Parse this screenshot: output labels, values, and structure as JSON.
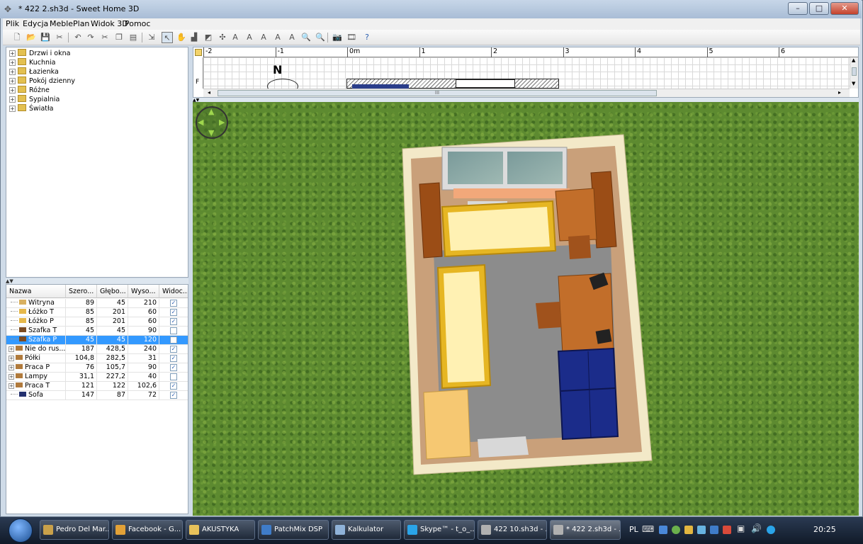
{
  "window": {
    "title": "* 422 2.sh3d - Sweet Home 3D",
    "minimize": "–",
    "maximize": "□",
    "close": "✕"
  },
  "menu": [
    "Plik",
    "Edycja",
    "Meble",
    "Plan",
    "Widok 3D",
    "Pomoc"
  ],
  "catalog": {
    "categories": [
      "Drzwi i okna",
      "Kuchnia",
      "Łazienka",
      "Pokój dzienny",
      "Różne",
      "Sypialnia",
      "Światła"
    ]
  },
  "furniture_table": {
    "headers": [
      "Nazwa",
      "Szero...",
      "Głębo...",
      "Wyso...",
      "Widoc..."
    ],
    "rows": [
      {
        "name": "Witryna",
        "w": "89",
        "d": "45",
        "h": "210",
        "visible": true,
        "group": false,
        "selected": false,
        "color": "#d8b060"
      },
      {
        "name": "Łóżko T",
        "w": "85",
        "d": "201",
        "h": "60",
        "visible": true,
        "group": false,
        "selected": false,
        "color": "#e6b84a"
      },
      {
        "name": "Łóżko P",
        "w": "85",
        "d": "201",
        "h": "60",
        "visible": true,
        "group": false,
        "selected": false,
        "color": "#e6b84a"
      },
      {
        "name": "Szafka T",
        "w": "45",
        "d": "45",
        "h": "90",
        "visible": false,
        "group": false,
        "selected": false,
        "color": "#7a4a22"
      },
      {
        "name": "Szafka P",
        "w": "45",
        "d": "45",
        "h": "120",
        "visible": false,
        "group": false,
        "selected": true,
        "color": "#7a4a22"
      },
      {
        "name": "Nie do rus...",
        "w": "187",
        "d": "428,5",
        "h": "240",
        "visible": true,
        "group": true,
        "selected": false,
        "color": "#b07a3c"
      },
      {
        "name": "Półki",
        "w": "104,8",
        "d": "282,5",
        "h": "31",
        "visible": true,
        "group": true,
        "selected": false,
        "color": "#b07a3c"
      },
      {
        "name": "Praca P",
        "w": "76",
        "d": "105,7",
        "h": "90",
        "visible": true,
        "group": true,
        "selected": false,
        "color": "#b07a3c"
      },
      {
        "name": "Lampy",
        "w": "31,1",
        "d": "227,2",
        "h": "40",
        "visible": false,
        "group": true,
        "selected": false,
        "color": "#b07a3c"
      },
      {
        "name": "Praca T",
        "w": "121",
        "d": "122",
        "h": "102,6",
        "visible": true,
        "group": true,
        "selected": false,
        "color": "#b07a3c"
      },
      {
        "name": "Sofa",
        "w": "147",
        "d": "87",
        "h": "72",
        "visible": true,
        "group": false,
        "selected": false,
        "color": "#23306e"
      }
    ]
  },
  "plan": {
    "ruler_labels": [
      "-2",
      "-1",
      "0m",
      "1",
      "2",
      "3",
      "4",
      "5",
      "6"
    ],
    "compass_label": "N",
    "side_label": "F",
    "scroll_grip": "III"
  },
  "taskbar": {
    "items": [
      {
        "label": "Pedro Del Mar...",
        "color": "#c9a14a"
      },
      {
        "label": "Facebook - G...",
        "color": "#e2a137"
      },
      {
        "label": "AKUSTYKA",
        "color": "#e8c25a"
      },
      {
        "label": "PatchMix DSP",
        "color": "#3f7cc8"
      },
      {
        "label": "Kalkulator",
        "color": "#8fb2d8"
      },
      {
        "label": "Skype™ - t_o_...",
        "color": "#2aa4e8"
      },
      {
        "label": "422 10.sh3d - ...",
        "color": "#b0b0b0"
      },
      {
        "label": "* 422 2.sh3d - ...",
        "color": "#b0b0b0"
      }
    ],
    "language": "PL",
    "clock": "20:25"
  },
  "colors": {
    "selection": "#3399ff",
    "grass": "#5d8a30",
    "floor": "#8a8a8a",
    "wall": "#f3e9c8",
    "bed": "#e6b623",
    "sofa": "#1b2c8a",
    "wood": "#9b4d16"
  }
}
